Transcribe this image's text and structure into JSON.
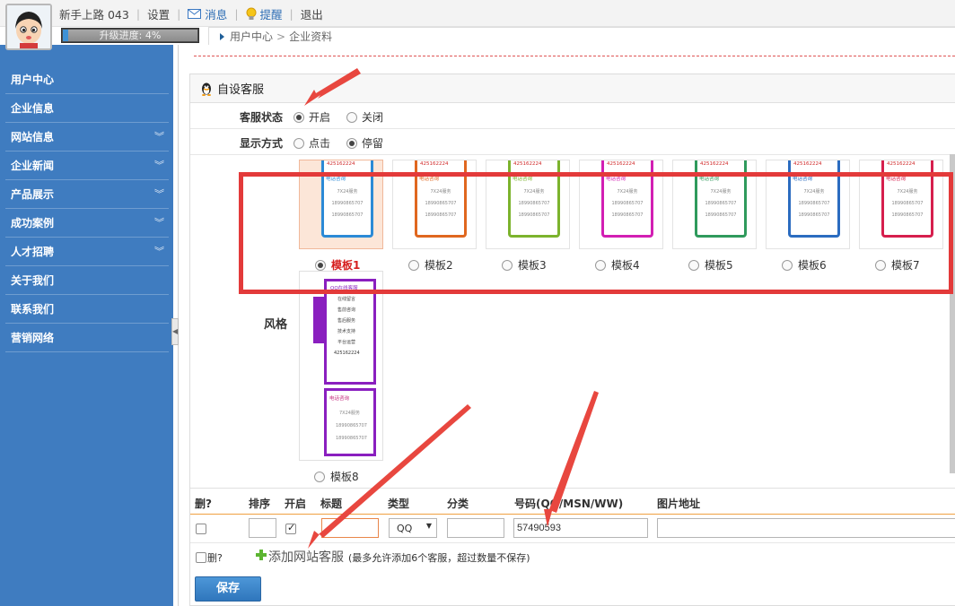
{
  "topbar": {
    "username": "新手上路 043",
    "settings": "设置",
    "messages": "消息",
    "reminders": "提醒",
    "logout": "退出"
  },
  "progress": {
    "label": "升级进度: 4%",
    "value": 0.04
  },
  "breadcrumb": {
    "home": "用户中心",
    "current": "企业资料"
  },
  "sidebar": {
    "items": [
      {
        "label": "用户中心",
        "expandable": false
      },
      {
        "label": "企业信息",
        "expandable": false
      },
      {
        "label": "网站信息",
        "expandable": true
      },
      {
        "label": "企业新闻",
        "expandable": true
      },
      {
        "label": "产品展示",
        "expandable": true
      },
      {
        "label": "成功案例",
        "expandable": true
      },
      {
        "label": "人才招聘",
        "expandable": true
      },
      {
        "label": "关于我们",
        "expandable": false
      },
      {
        "label": "联系我们",
        "expandable": false
      },
      {
        "label": "营销网络",
        "expandable": false
      }
    ]
  },
  "panel": {
    "title": "自设客服"
  },
  "status_row": {
    "label": "客服状态",
    "on": "开启",
    "off": "关闭",
    "selected": "on"
  },
  "display_row": {
    "label": "显示方式",
    "click": "点击",
    "stay": "停留",
    "selected": "stay"
  },
  "style": {
    "label": "风格",
    "templates": [
      {
        "label": "模板1",
        "color": "#2b8ad6",
        "selected": true
      },
      {
        "label": "模板2",
        "color": "#e0671f"
      },
      {
        "label": "模板3",
        "color": "#7cb32d"
      },
      {
        "label": "模板4",
        "color": "#d21fb3"
      },
      {
        "label": "模板5",
        "color": "#2f9a5c"
      },
      {
        "label": "模板6",
        "color": "#2b6cc0"
      },
      {
        "label": "模板7",
        "color": "#d61f4d"
      }
    ],
    "card_top": "425162224",
    "card_head": "电话咨询",
    "card_service": "7X24服务",
    "card_phone": "18990865707",
    "template8": {
      "label": "模板8",
      "title": "QQ在线客服",
      "tab": "在线客服",
      "items": [
        "在线留言",
        "售前咨询",
        "售后服务",
        "技术支持",
        "平台运营"
      ]
    }
  },
  "table": {
    "headers": {
      "del": "删?",
      "order": "排序",
      "enabled": "开启",
      "title": "标题",
      "type": "类型",
      "category": "分类",
      "number": "号码(QQ/MSN/WW)",
      "image": "图片地址"
    },
    "row": {
      "order": "",
      "enabled": true,
      "title": "",
      "type": "QQ",
      "category": "",
      "number": "57490593",
      "image": ""
    },
    "add_del": "删?",
    "add_link": "添加网站客服",
    "add_note": "(最多允许添加6个客服，超过数量不保存)"
  },
  "save_label": "保存",
  "colors": {
    "sidebar": "#3f7cc0",
    "annotation": "#e33a3a",
    "accent": "#2f76bc"
  }
}
